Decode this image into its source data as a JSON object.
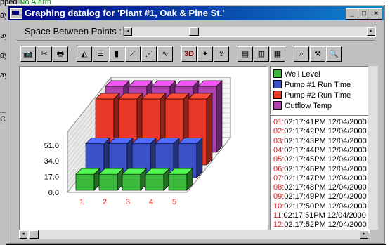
{
  "background_window": {
    "line1": "pped",
    "line1_status": "No Alarm",
    "side_letters": [
      "ay",
      "ay",
      "ay",
      "ay"
    ],
    "box_text": "Cl"
  },
  "window": {
    "title": "Graphing datalog for 'Plant #1, Oak & Pine St.'",
    "controls": {
      "minimize": "_",
      "maximize": "□",
      "close": "×"
    }
  },
  "spacing": {
    "label": "Space Between Points :",
    "left_arrow": "◂",
    "right_arrow": "▸",
    "value": 0.25
  },
  "toolbar": {
    "buttons": [
      {
        "name": "camera-icon",
        "glyph": "📷"
      },
      {
        "name": "cut-icon",
        "glyph": "✂"
      },
      {
        "name": "print-icon",
        "glyph": "🖶"
      },
      {
        "name": "area-chart-icon",
        "glyph": "◭"
      },
      {
        "name": "hbar-chart-icon",
        "glyph": "☰"
      },
      {
        "name": "bar-chart-icon",
        "glyph": "▮"
      },
      {
        "name": "line-chart-icon",
        "glyph": "⟋"
      },
      {
        "name": "scatter-chart-icon",
        "glyph": "⋰"
      },
      {
        "name": "step-chart-icon",
        "glyph": "∿"
      },
      {
        "name": "3d-toggle-icon",
        "glyph": "3D"
      },
      {
        "name": "rotate-icon",
        "glyph": "✦"
      },
      {
        "name": "export-icon",
        "glyph": "⇪"
      },
      {
        "name": "page-icon",
        "glyph": "▤"
      },
      {
        "name": "columns-icon",
        "glyph": "▥"
      },
      {
        "name": "rows-icon",
        "glyph": "▦"
      },
      {
        "name": "zoom-icon",
        "glyph": "⌕"
      },
      {
        "name": "tools-icon",
        "glyph": "⚒"
      },
      {
        "name": "search-icon",
        "glyph": "🔍"
      }
    ]
  },
  "colors": {
    "well_level": "#3cb83c",
    "pump1": "#3c50c8",
    "pump2": "#e83828",
    "outflow": "#b040b0",
    "index_red": "#d42020"
  },
  "chart_data": {
    "type": "bar",
    "categories": [
      "1",
      "2",
      "3",
      "4",
      "5"
    ],
    "y_ticks": [
      "51.0",
      "34.0",
      "17.0",
      "0.0"
    ],
    "ylim": [
      0,
      51
    ],
    "series": [
      {
        "name": "Well Level",
        "values": [
          9,
          9,
          9,
          9,
          9
        ]
      },
      {
        "name": "Pump #1 Run Time",
        "values": [
          19,
          19,
          19,
          19,
          19
        ]
      },
      {
        "name": "Pump #2 Run Time",
        "values": [
          37,
          37,
          37,
          37,
          37
        ]
      },
      {
        "name": "Outflow Temp",
        "values": [
          37,
          37,
          37,
          37,
          37
        ]
      }
    ]
  },
  "legend": {
    "items": [
      "Well Level",
      "Pump #1 Run Time",
      "Pump #2 Run Time",
      "Outflow Temp"
    ]
  },
  "timestamps": [
    {
      "idx": "01:",
      "time": "02:17:41PM 12/04/2000"
    },
    {
      "idx": "02:",
      "time": "02:17:42PM 12/04/2000"
    },
    {
      "idx": "03:",
      "time": "02:17:43PM 12/04/2000"
    },
    {
      "idx": "04:",
      "time": "02:17:44PM 12/04/2000"
    },
    {
      "idx": "05:",
      "time": "02:17:45PM 12/04/2000"
    },
    {
      "idx": "06:",
      "time": "02:17:46PM 12/04/2000"
    },
    {
      "idx": "07:",
      "time": "02:17:47PM 12/04/2000"
    },
    {
      "idx": "08:",
      "time": "02:17:48PM 12/04/2000"
    },
    {
      "idx": "09:",
      "time": "02:17:49PM 12/04/2000"
    },
    {
      "idx": "10:",
      "time": "02:17:50PM 12/04/2000"
    },
    {
      "idx": "11:",
      "time": "02:17:51PM 12/04/2000"
    },
    {
      "idx": "12:",
      "time": "02:17:52PM 12/04/2000"
    }
  ],
  "scroll": {
    "left_arrow": "◂",
    "right_arrow": "▸"
  }
}
